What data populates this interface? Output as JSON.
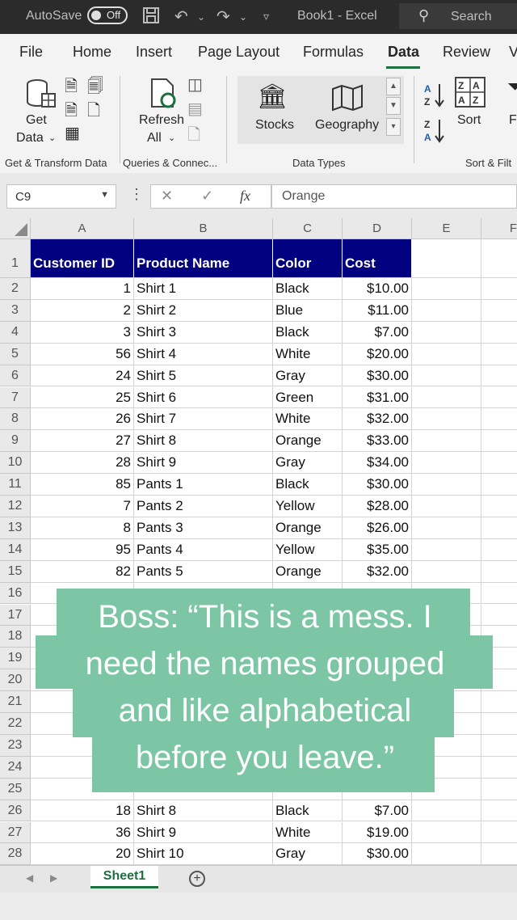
{
  "titlebar": {
    "autosave_label": "AutoSave",
    "autosave_state": "Off",
    "book_title": "Book1  -  Excel",
    "search_placeholder": "Search"
  },
  "menu": {
    "items": [
      "File",
      "Home",
      "Insert",
      "Page Layout",
      "Formulas",
      "Data",
      "Review"
    ],
    "active": "Data",
    "overflow": "V"
  },
  "ribbon": {
    "get_data_line1": "Get",
    "get_data_line2": "Data",
    "refresh_line1": "Refresh",
    "refresh_line2": "All",
    "stocks": "Stocks",
    "geography": "Geography",
    "sort": "Sort",
    "filter_partial": "Fi",
    "group_get_transform": "Get & Transform Data",
    "group_queries": "Queries & Connec...",
    "group_data_types": "Data Types",
    "group_sort_filter": "Sort & Filt"
  },
  "formula_bar": {
    "name_box": "C9",
    "value": "Orange"
  },
  "columns": [
    "A",
    "B",
    "C",
    "D",
    "E",
    "F"
  ],
  "rows": [
    {
      "n": "1",
      "a": "Customer ID",
      "b": "Product Name",
      "c": "Color",
      "d": "Cost",
      "header": true
    },
    {
      "n": "2",
      "a": "1",
      "b": "Shirt 1",
      "c": "Black",
      "d": "$10.00"
    },
    {
      "n": "3",
      "a": "2",
      "b": "Shirt 2",
      "c": "Blue",
      "d": "$11.00"
    },
    {
      "n": "4",
      "a": "3",
      "b": "Shirt 3",
      "c": "Black",
      "d": "$7.00"
    },
    {
      "n": "5",
      "a": "56",
      "b": "Shirt 4",
      "c": "White",
      "d": "$20.00"
    },
    {
      "n": "6",
      "a": "24",
      "b": "Shirt 5",
      "c": "Gray",
      "d": "$30.00"
    },
    {
      "n": "7",
      "a": "25",
      "b": "Shirt 6",
      "c": "Green",
      "d": "$31.00"
    },
    {
      "n": "8",
      "a": "26",
      "b": "Shirt 7",
      "c": "White",
      "d": "$32.00"
    },
    {
      "n": "9",
      "a": "27",
      "b": "Shirt 8",
      "c": "Orange",
      "d": "$33.00"
    },
    {
      "n": "10",
      "a": "28",
      "b": "Shirt 9",
      "c": "Gray",
      "d": "$34.00"
    },
    {
      "n": "11",
      "a": "85",
      "b": "Pants 1",
      "c": "Black",
      "d": "$30.00"
    },
    {
      "n": "12",
      "a": "7",
      "b": "Pants 2",
      "c": "Yellow",
      "d": "$28.00"
    },
    {
      "n": "13",
      "a": "8",
      "b": "Pants 3",
      "c": "Orange",
      "d": "$26.00"
    },
    {
      "n": "14",
      "a": "95",
      "b": "Pants 4",
      "c": "Yellow",
      "d": "$35.00"
    },
    {
      "n": "15",
      "a": "82",
      "b": "Pants 5",
      "c": "Orange",
      "d": "$32.00"
    },
    {
      "n": "16",
      "a": "",
      "b": "",
      "c": "",
      "d": ""
    },
    {
      "n": "17",
      "a": "",
      "b": "",
      "c": "",
      "d": ""
    },
    {
      "n": "18",
      "a": "",
      "b": "",
      "c": "",
      "d": ""
    },
    {
      "n": "19",
      "a": "",
      "b": "",
      "c": "",
      "d": ""
    },
    {
      "n": "20",
      "a": "",
      "b": "",
      "c": "",
      "d": ""
    },
    {
      "n": "21",
      "a": "",
      "b": "",
      "c": "",
      "d": ""
    },
    {
      "n": "22",
      "a": "",
      "b": "",
      "c": "",
      "d": ""
    },
    {
      "n": "23",
      "a": "",
      "b": "",
      "c": "",
      "d": ""
    },
    {
      "n": "24",
      "a": "",
      "b": "",
      "c": "",
      "d": ""
    },
    {
      "n": "25",
      "a": "",
      "b": "",
      "c": "",
      "d": ""
    },
    {
      "n": "26",
      "a": "18",
      "b": "Shirt 8",
      "c": "Black",
      "d": "$7.00"
    },
    {
      "n": "27",
      "a": "36",
      "b": "Shirt 9",
      "c": "White",
      "d": "$19.00"
    },
    {
      "n": "28",
      "a": "20",
      "b": "Shirt 10",
      "c": "Gray",
      "d": "$30.00"
    }
  ],
  "sheet_tab": "Sheet1",
  "caption": {
    "line1": "Boss: “This is a mess. I",
    "line2": "need the names grouped",
    "line3": "and like alphabetical",
    "line4": "before you leave.”"
  },
  "colors": {
    "header_fill": "#000080",
    "caption_bg": "#7cc5a5",
    "excel_green": "#1e6f3f"
  }
}
